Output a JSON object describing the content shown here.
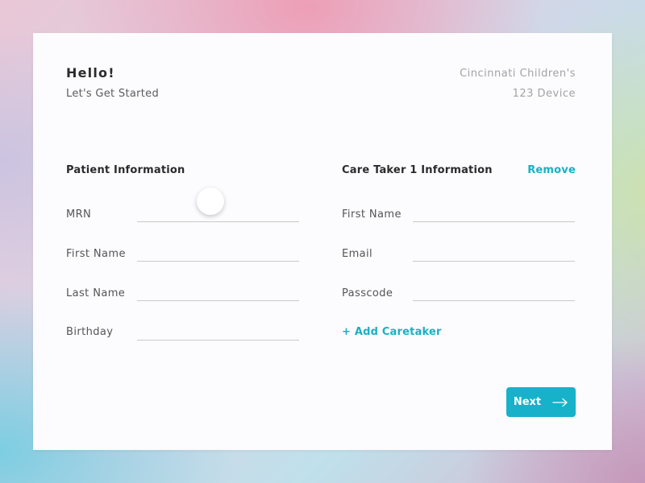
{
  "header": {
    "greeting": "Hello!",
    "subtitle": "Let's Get Started",
    "organization": "Cincinnati Children's",
    "device": "123 Device"
  },
  "patient": {
    "title": "Patient Information",
    "fields": {
      "mrn": {
        "label": "MRN",
        "value": ""
      },
      "first_name": {
        "label": "First Name",
        "value": ""
      },
      "last_name": {
        "label": "Last Name",
        "value": ""
      },
      "birthday": {
        "label": "Birthday",
        "value": ""
      }
    }
  },
  "caretaker": {
    "title": "Care Taker 1 Information",
    "remove_label": "Remove",
    "fields": {
      "first_name": {
        "label": "First Name",
        "value": ""
      },
      "email": {
        "label": "Email",
        "value": ""
      },
      "passcode": {
        "label": "Passcode",
        "value": ""
      }
    },
    "add_label": "+ Add Caretaker"
  },
  "actions": {
    "next_label": "Next",
    "next_icon": "arrow-right-icon"
  },
  "colors": {
    "accent": "#17b1c9",
    "link": "#1ab0c4",
    "text_primary": "#2b2b2b",
    "text_muted": "#a3a3a3",
    "card_background": "#fcfbfd"
  }
}
